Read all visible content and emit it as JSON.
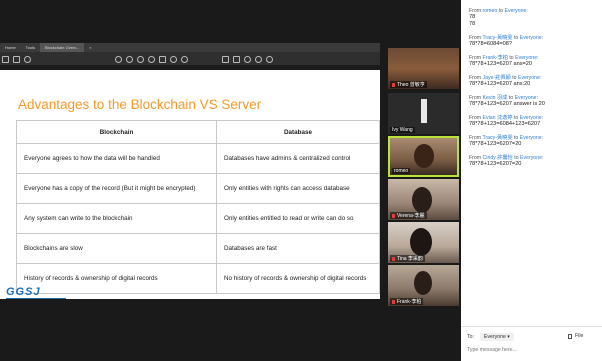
{
  "viewer": {
    "tabs": [
      "Home",
      "Tools",
      "Blockchain Overv...",
      "×"
    ]
  },
  "slide": {
    "title": "Advantages to the Blockchain VS Server",
    "columns": [
      "Blockchain",
      "Database"
    ],
    "rows": [
      [
        "Everyone agrees to how the data will be handled",
        "Databases have admins & centralized control"
      ],
      [
        "Everyone has a copy of the record (But it might be encrypted)",
        "Only entities with rights can access database"
      ],
      [
        "Any system can write to the blockchain",
        "Only entities entitled to read or write can do so"
      ],
      [
        "Blockchains are slow",
        "Databases are fast"
      ],
      [
        "History of records & ownership of digital records",
        "No history of records & ownership of digital records"
      ]
    ],
    "logo": "GGSJ"
  },
  "participants": [
    {
      "name": "Theo 曾敏亨",
      "active": false,
      "muted": true
    },
    {
      "name": "Ivy Wang",
      "active": false,
      "muted": false
    },
    {
      "name": "romeo",
      "active": true,
      "muted": false
    },
    {
      "name": "Verena-李麗",
      "active": false,
      "muted": true
    },
    {
      "name": "Tina 李采韵",
      "active": false,
      "muted": true
    },
    {
      "name": "Frank-李柏",
      "active": false,
      "muted": true
    }
  ],
  "chat": {
    "messages": [
      {
        "from": "romeo",
        "to": "Everyone",
        "lines": [
          "78",
          "78"
        ]
      },
      {
        "from": "Tracy-黃曉雯",
        "to": "Everyone",
        "lines": [
          "78*78=6084=08?"
        ]
      },
      {
        "from": "Frank-李柏",
        "to": "Everyone",
        "lines": [
          "78*78+123=6207 ans=20"
        ]
      },
      {
        "from": "Jaye-莊佩穎",
        "to": "Everyone",
        "lines": [
          "78*78+123=6207 ans:20"
        ]
      },
      {
        "from": "Kevin 羽成",
        "to": "Everyone",
        "lines": [
          "78*78+123=6207 answer is 20"
        ]
      },
      {
        "from": "Evian 沈逸婷",
        "to": "Everyone",
        "lines": [
          "78*78+123=6084+123=6207"
        ]
      },
      {
        "from": "Tracy-黃曉雯",
        "to": "Everyone",
        "lines": [
          "78*78+123=6207=20"
        ]
      },
      {
        "from": "Cindy 許馨怡",
        "to": "Everyone",
        "lines": [
          "78*78+123=6207=20"
        ]
      }
    ],
    "to_label": "To:",
    "to_value": "Everyone",
    "file_label": "File",
    "input_placeholder": "Type message here..."
  }
}
